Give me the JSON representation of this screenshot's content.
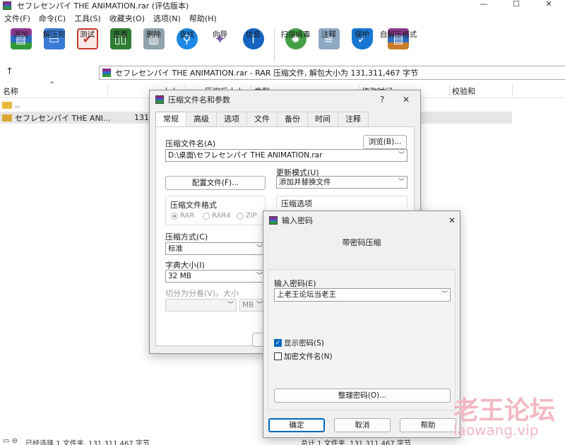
{
  "window": {
    "title": "セフレセンパイ THE ANIMATION.rar (评估版本)",
    "controls": [
      "—",
      "☐",
      "✕"
    ]
  },
  "menu": [
    "文件(F)",
    "命令(C)",
    "工具(S)",
    "收藏夹(O)",
    "选项(N)",
    "帮助(H)"
  ],
  "toolbar": [
    {
      "label": "添加",
      "icon": "add-archive-icon",
      "color": "#8e3a8f"
    },
    {
      "label": "解压到",
      "icon": "extract-folder-icon",
      "color": "#3a7bd5"
    },
    {
      "label": "测试",
      "icon": "test-clipboard-icon",
      "color": "#c0392b"
    },
    {
      "label": "查看",
      "icon": "view-book-icon",
      "color": "#2e7d32"
    },
    {
      "label": "删除",
      "icon": "delete-trash-icon",
      "color": "#607d8b"
    },
    {
      "label": "查找",
      "icon": "find-magnifier-icon",
      "color": "#1e88e5"
    },
    {
      "label": "向导",
      "icon": "wizard-wand-icon",
      "color": "#7b5ea7"
    },
    {
      "label": "信息",
      "icon": "info-icon",
      "color": "#1565c0"
    },
    {
      "label": "扫描病毒",
      "icon": "virus-scan-icon",
      "color": "#43a047"
    },
    {
      "label": "注释",
      "icon": "comment-icon",
      "color": "#5c7a99"
    },
    {
      "label": "保护",
      "icon": "protect-shield-icon",
      "color": "#1976d2"
    },
    {
      "label": "自解压格式",
      "icon": "sfx-archive-icon",
      "color": "#c77d2a"
    }
  ],
  "path": {
    "up": "↑",
    "text": "セフレセンパイ THE ANIMATION.rar - RAR 压缩文件, 解包大小为 131,311,467 字节"
  },
  "filelist": {
    "columns": {
      "name": "名称",
      "size": "大小",
      "packed": "压缩后大小",
      "type": "类型",
      "modified": "修改时间",
      "crc": "校验和"
    },
    "rows": [
      {
        "name": "..",
        "size": ""
      },
      {
        "name": "セフレセンパイ THE ANI...",
        "size": "131,"
      }
    ]
  },
  "status": {
    "left": "已经选择 1 文件夹, 131,311,467 字节",
    "right": "总计 1 文件夹, 131,311,467 字节"
  },
  "archive_dialog": {
    "title": "压缩文件名和参数",
    "help": "?",
    "close": "✕",
    "tabs": [
      "常规",
      "高级",
      "选项",
      "文件",
      "备份",
      "时间",
      "注释"
    ],
    "filename_label": "压缩文件名(A)",
    "browse": "浏览(B)...",
    "filename_value": "D:\\桌面\\セフレセンパイ THE ANIMATION.rar",
    "profiles": "配置文件(F)...",
    "update_label": "更新模式(U)",
    "update_value": "添加并替换文件",
    "format_label": "压缩文件格式",
    "formats": [
      "RAR",
      "RAR4",
      "ZIP"
    ],
    "options_label": "压缩选项",
    "method_label": "压缩方式(C)",
    "method_value": "标准",
    "dict_label": "字典大小(I)",
    "dict_value": "32 MB",
    "split_label": "切分为分卷(V)，大小",
    "split_unit": "MB"
  },
  "password_dialog": {
    "title": "输入密码",
    "close": "✕",
    "heading": "带密码压缩",
    "password_label": "输入密码(E)",
    "password_value": "上老王论坛当老王",
    "show_password": "显示密码(S)",
    "encrypt_names": "加密文件名(N)",
    "organize": "整理密码(O)...",
    "ok": "确定",
    "cancel": "取消",
    "help": "帮助"
  },
  "watermark": {
    "main": "老王论坛",
    "sub": "laowang.vip"
  }
}
